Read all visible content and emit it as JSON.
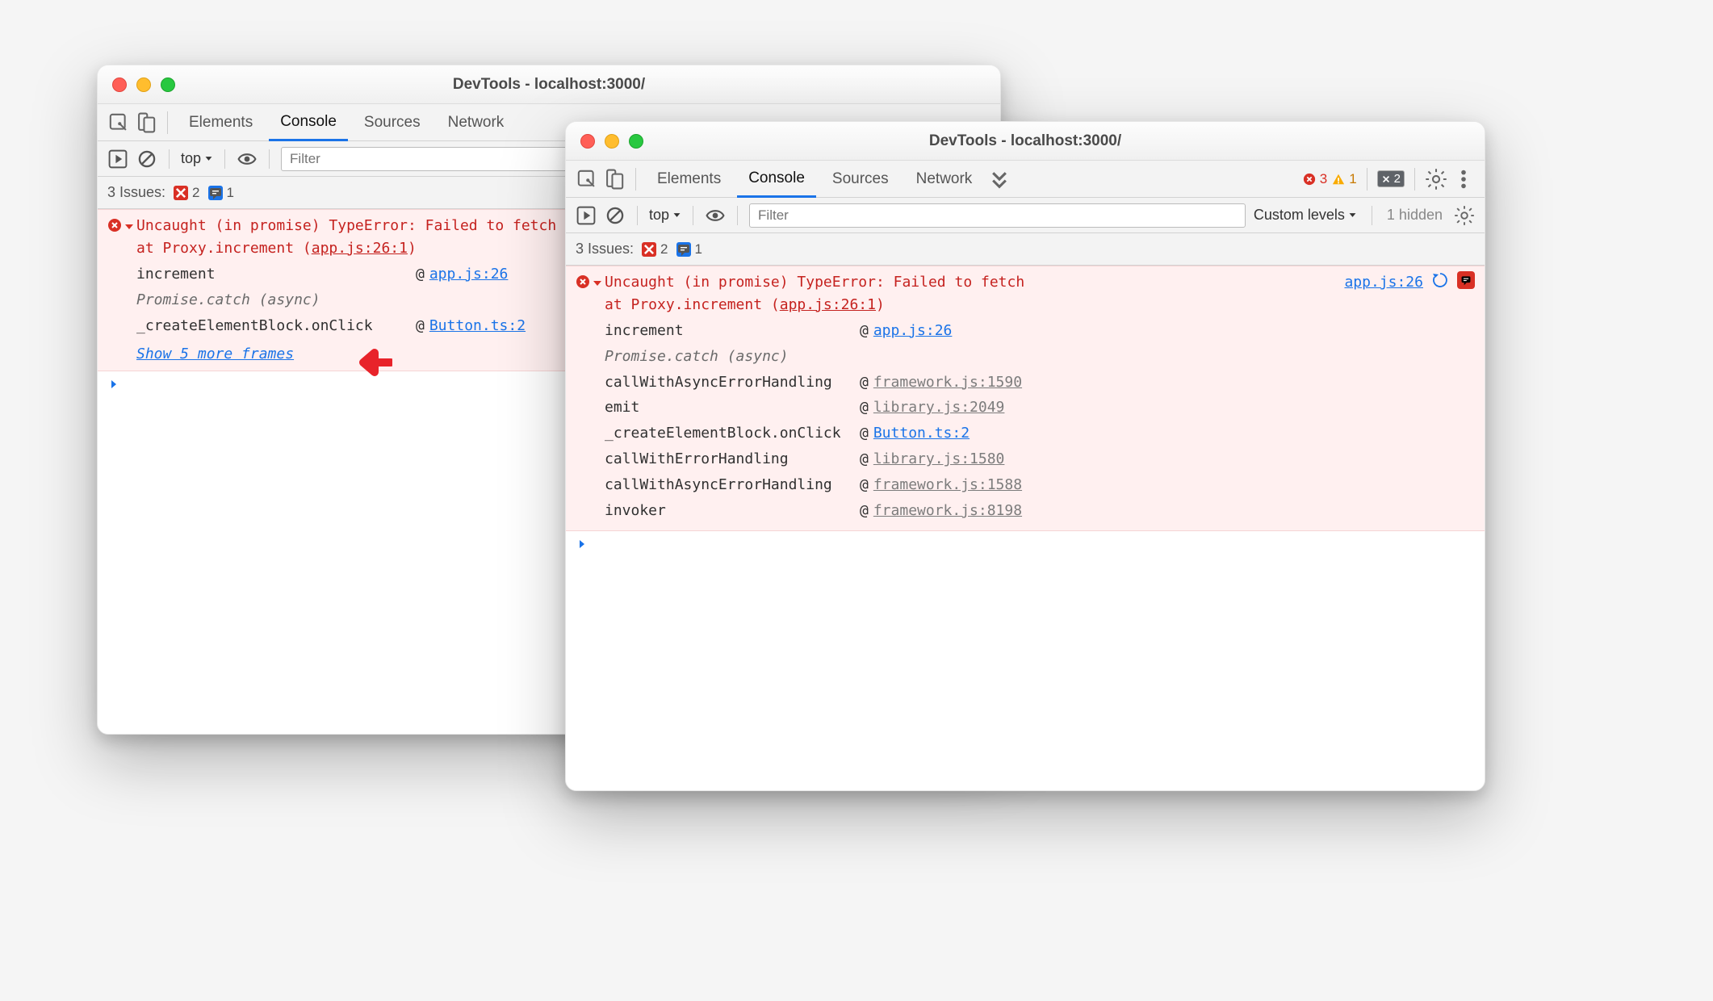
{
  "window_title": "DevTools - localhost:3000/",
  "tabs": {
    "elements": "Elements",
    "console": "Console",
    "sources": "Sources",
    "network": "Network"
  },
  "top_status_right": {
    "error_count": "3",
    "warn_count": "1",
    "msg_count": "2"
  },
  "left_top_status_right": {
    "error_prefix": "",
    "msg_count": "1"
  },
  "subbar": {
    "context": "top",
    "filter_placeholder": "Filter",
    "levels": "Custom levels",
    "hidden": "1 hidden"
  },
  "issues": {
    "label": "3 Issues:",
    "counts": {
      "red": "2",
      "blue": "1"
    }
  },
  "error": {
    "message_line1": "Uncaught (in promise) TypeError: Failed to fetch",
    "message_line2a": "    at Proxy.increment (",
    "message_line2b": "app.js:26:1",
    "message_line2c": ")",
    "source_link": "app.js:26"
  },
  "stack_left_fnw": "340px",
  "stack_right_fnw": "310px",
  "stack_left": [
    {
      "fn": "increment",
      "loc": "app.js:26",
      "muted": false
    },
    {
      "async": "Promise.catch (async)"
    },
    {
      "fn": "_createElementBlock.onClick",
      "loc": "Button.ts:2",
      "muted": false
    }
  ],
  "show_more_left": "Show 5 more frames",
  "stack_right": [
    {
      "fn": "increment",
      "loc": "app.js:26",
      "muted": false
    },
    {
      "async": "Promise.catch (async)"
    },
    {
      "fn": "callWithAsyncErrorHandling",
      "loc": "framework.js:1590",
      "muted": true
    },
    {
      "fn": "emit",
      "loc": "library.js:2049",
      "muted": true
    },
    {
      "fn": "_createElementBlock.onClick",
      "loc": "Button.ts:2",
      "muted": false
    },
    {
      "fn": "callWithErrorHandling",
      "loc": "library.js:1580",
      "muted": true
    },
    {
      "fn": "callWithAsyncErrorHandling",
      "loc": "framework.js:1588",
      "muted": true
    },
    {
      "fn": "invoker",
      "loc": "framework.js:8198",
      "muted": true
    }
  ]
}
